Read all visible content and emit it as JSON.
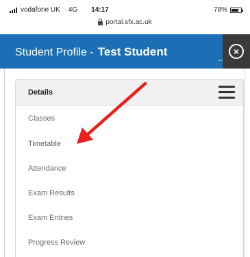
{
  "status_bar": {
    "carrier": "vodafone UK",
    "network": "4G",
    "time": "14:17",
    "battery": "78%",
    "battery_level": 0.78
  },
  "browser": {
    "url": "portal.sfx.ac.uk"
  },
  "header": {
    "label": "Student Profile -",
    "student_name": "Test Student",
    "overflow": "..",
    "close_glyph": "×",
    "color": "#1c6fb4"
  },
  "card": {
    "title": "Details",
    "menu_items": [
      "Classes",
      "Timetable",
      "Attendance",
      "Exam Results",
      "Exam Entries",
      "Progress Review"
    ]
  },
  "annotation": {
    "arrow_color": "#e8211b"
  }
}
